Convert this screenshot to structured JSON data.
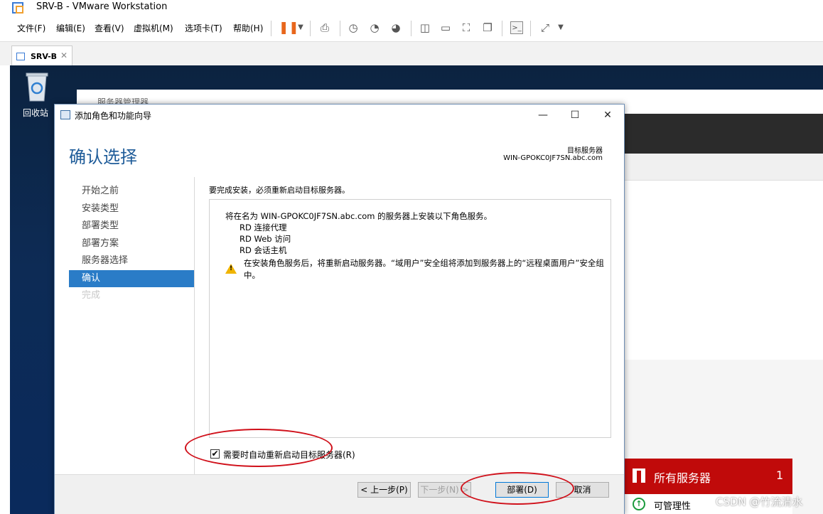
{
  "vmware": {
    "window_title": "SRV-B - VMware Workstation",
    "menus": [
      "文件(F)",
      "编辑(E)",
      "查看(V)",
      "虚拟机(M)",
      "选项卡(T)",
      "帮助(H)"
    ],
    "tab_label": "SRV-B",
    "tab_close": "✕"
  },
  "desktop": {
    "recycle_bin_label": "回收站"
  },
  "server_manager": {
    "title": "服务器管理器",
    "tile_all_servers_label": "所有服务器",
    "tile_all_servers_count": "1",
    "manageability_label": "可管理性"
  },
  "wizard": {
    "title": "添加角色和功能向导",
    "heading": "确认选择",
    "target_label": "目标服务器",
    "target_server": "WIN-GPOKC0JF7SN.abc.com",
    "nav": [
      {
        "label": "开始之前",
        "state": "normal"
      },
      {
        "label": "安装类型",
        "state": "normal"
      },
      {
        "label": "部署类型",
        "state": "normal"
      },
      {
        "label": "部署方案",
        "state": "normal"
      },
      {
        "label": "服务器选择",
        "state": "normal"
      },
      {
        "label": "确认",
        "state": "active"
      },
      {
        "label": "完成",
        "state": "disabled"
      }
    ],
    "restart_note": "要完成安装，必须重新启动目标服务器。",
    "install_line": "将在名为 WIN-GPOKC0JF7SN.abc.com 的服务器上安装以下角色服务。",
    "roles": [
      "RD 连接代理",
      "RD Web 访问",
      "RD 会话主机"
    ],
    "warning_text": "在安装角色服务后，将重新启动服务器。“域用户”安全组将添加到服务器上的“远程桌面用户”安全组中。",
    "auto_restart_checked": true,
    "auto_restart_label": "需要时自动重新启动目标服务器(R)",
    "buttons": {
      "back": "< 上一步(P)",
      "next": "下一步(N) >",
      "deploy": "部署(D)",
      "cancel": "取消"
    },
    "window_controls": {
      "minimize": "—",
      "maximize": "☐",
      "close": "✕"
    }
  },
  "watermark": "CSDN @竹流清水",
  "colors": {
    "accent": "#2a7cc7",
    "heading": "#1f5c99",
    "all_servers_tile": "#c00a0a",
    "annotation": "#d0101a",
    "warning": "#f0b400"
  }
}
